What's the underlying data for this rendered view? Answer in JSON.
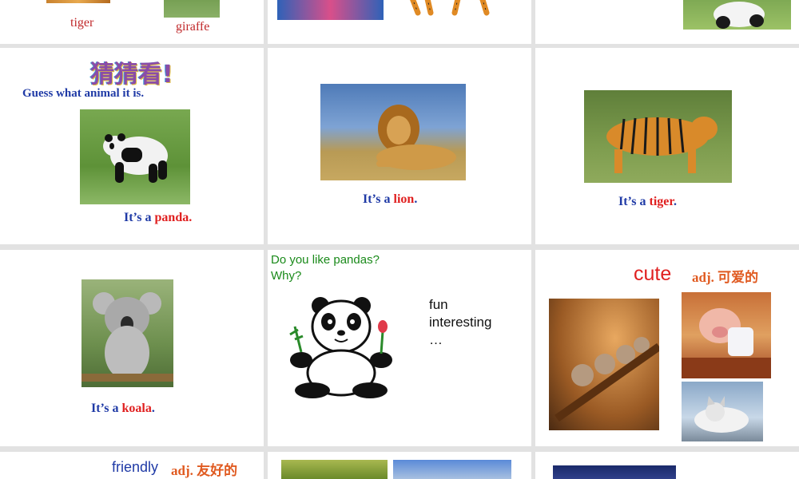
{
  "colors": {
    "page_bg": "#e2e2e2",
    "slide_bg": "#ffffff",
    "caption_blue": "#1f3aa6",
    "caption_red": "#e02020",
    "green_text": "#1a8a1a"
  },
  "slide_1": {
    "label_tiger": "tiger",
    "label_giraffe": "giraffe"
  },
  "slide_4": {
    "title": "猜猜看!",
    "prompt": "Guess what animal it is.",
    "caption_prefix": "It’s a ",
    "caption_animal": "panda",
    "caption_suffix": "."
  },
  "slide_5": {
    "caption_prefix": "It’s a ",
    "caption_animal": "lion",
    "caption_suffix": "."
  },
  "slide_6": {
    "caption_prefix": "It’s a ",
    "caption_animal": "tiger",
    "caption_suffix": "."
  },
  "slide_7": {
    "caption_prefix": "It’s a ",
    "caption_animal": "koala",
    "caption_suffix": "."
  },
  "slide_8": {
    "question_line1": "Do you like pandas?",
    "question_line2": "Why?",
    "answers": [
      "fun",
      "interesting",
      "…"
    ]
  },
  "slide_9": {
    "word": "cute",
    "definition": "adj. 可爱的"
  },
  "slide_10": {
    "word": "friendly",
    "definition": "adj. 友好的"
  }
}
